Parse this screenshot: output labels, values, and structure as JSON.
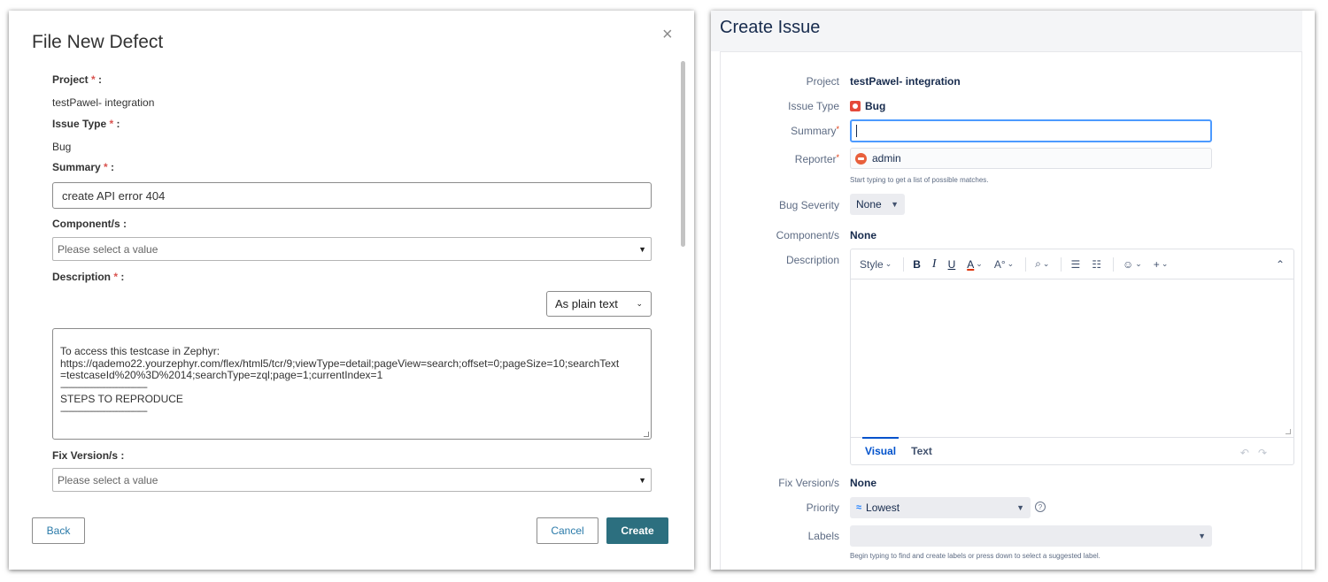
{
  "left_dialog": {
    "title": "File New Defect",
    "close_symbol": "×",
    "project": {
      "label": "Project",
      "required_mark": "*",
      "suffix": " :",
      "value": "testPawel- integration"
    },
    "issue_type": {
      "label": "Issue Type",
      "required_mark": "*",
      "suffix": " :",
      "value": "Bug"
    },
    "summary": {
      "label": "Summary",
      "required_mark": "*",
      "suffix": " :",
      "value": "create API error 404"
    },
    "components": {
      "label": "Component/s :",
      "placeholder": "Please select a value"
    },
    "description": {
      "label": "Description",
      "required_mark": "*",
      "suffix": " :",
      "format_selected": "As plain text",
      "lines": [
        "To access this testcase in Zephyr:",
        "https://qademo22.yourzephyr.com/flex/html5/tcr/9;viewType=detail;pageView=search;offset=0;pageSize=10;searchText",
        "=testcaseId%20%3D%2014;searchType=zql;page=1;currentIndex=1",
        "------------------------------------------",
        "STEPS TO REPRODUCE",
        "------------------------------------------"
      ]
    },
    "fix_versions": {
      "label": "Fix Version/s :",
      "placeholder": "Please select a value"
    },
    "buttons": {
      "back": "Back",
      "cancel": "Cancel",
      "create": "Create"
    }
  },
  "right_form": {
    "title": "Create Issue",
    "project": {
      "label": "Project",
      "value": "testPawel- integration"
    },
    "issue_type": {
      "label": "Issue Type",
      "value": "Bug"
    },
    "summary": {
      "label": "Summary",
      "required_mark": "*",
      "value": ""
    },
    "reporter": {
      "label": "Reporter",
      "required_mark": "*",
      "value": "admin",
      "hint": "Start typing to get a list of possible matches."
    },
    "bug_severity": {
      "label": "Bug Severity",
      "value": "None"
    },
    "components": {
      "label": "Component/s",
      "value": "None"
    },
    "description": {
      "label": "Description",
      "toolbar": {
        "style": "Style",
        "bold": "B",
        "italic": "I",
        "underline": "U",
        "text_color": "A",
        "more_formatting": "A°",
        "link": "⌕",
        "bullet_list": "☰",
        "numbered_list": "☷",
        "emoji": "☺",
        "insert": "+",
        "collapse": "⌃"
      },
      "tabs": {
        "visual": "Visual",
        "text": "Text"
      },
      "undo_redo": "↶↷"
    },
    "fix_versions": {
      "label": "Fix Version/s",
      "value": "None"
    },
    "priority": {
      "label": "Priority",
      "value": "Lowest",
      "icon": "≈",
      "help": "?"
    },
    "labels": {
      "label": "Labels",
      "value": "",
      "hint": "Begin typing to find and create labels or press down to select a suggested label."
    }
  }
}
